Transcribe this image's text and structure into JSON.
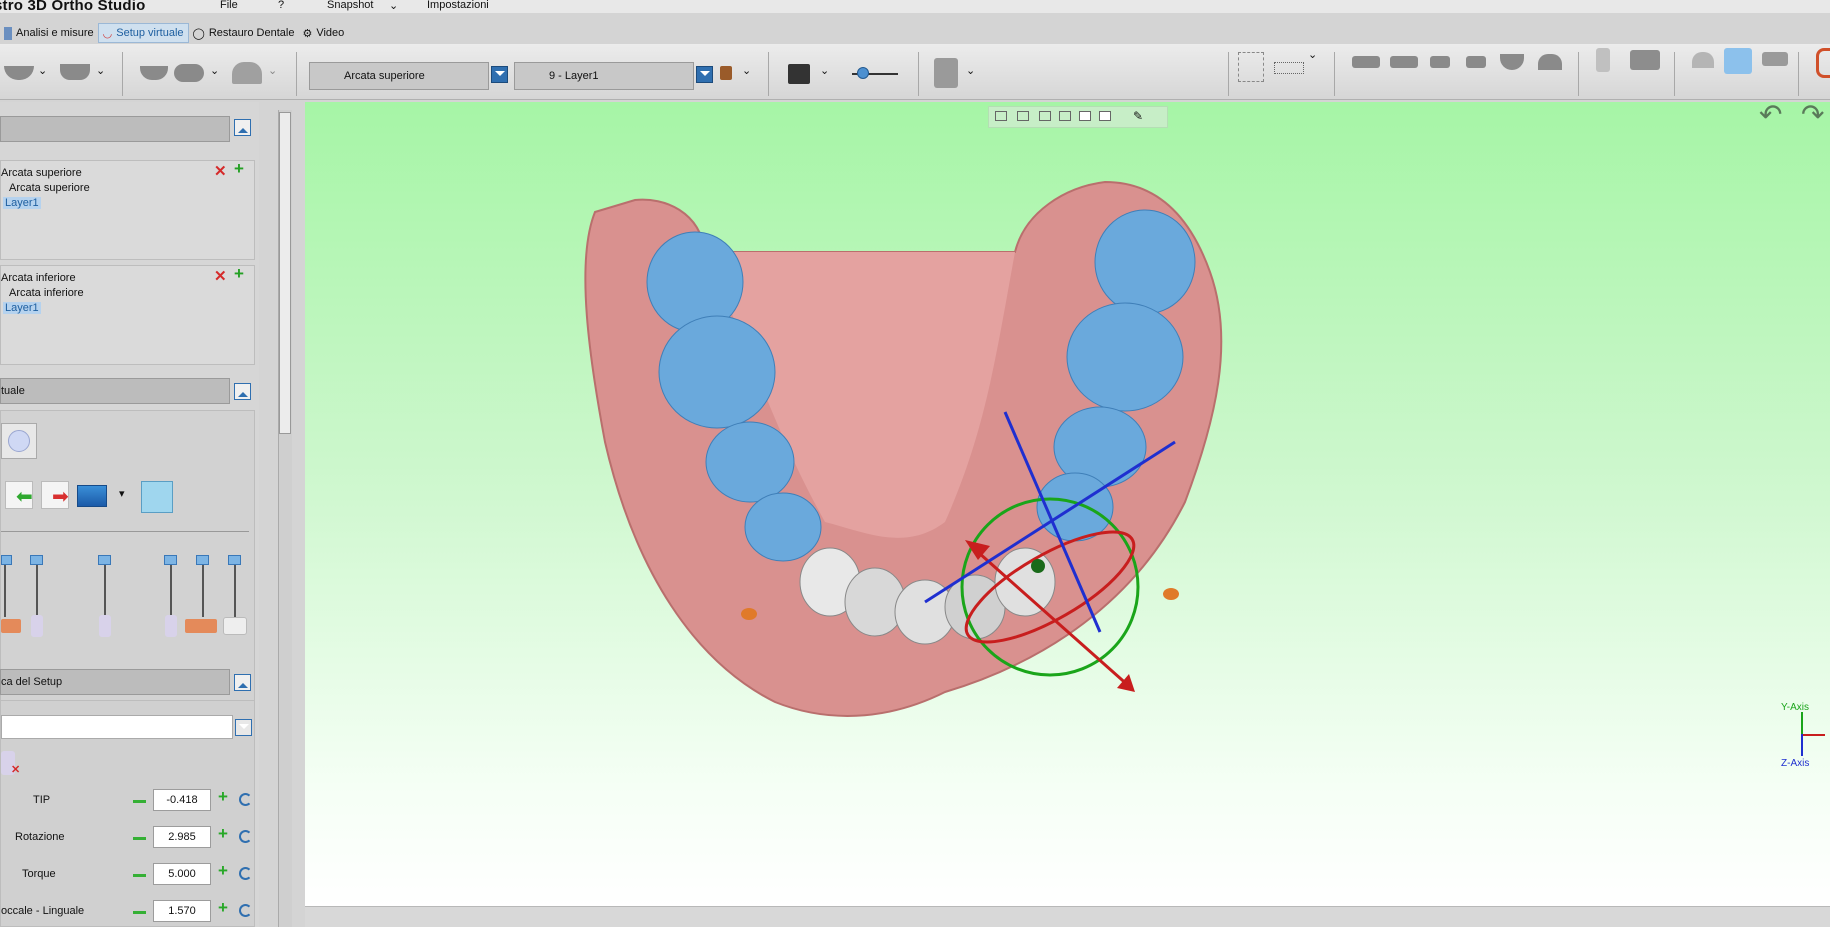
{
  "app": {
    "title": "stro 3D Ortho Studio"
  },
  "menu": [
    "File",
    "?",
    "Snapshot",
    "Impostazioni"
  ],
  "tabs": [
    {
      "label": "Analisi e misure",
      "active": false
    },
    {
      "label": "Setup virtuale",
      "active": true
    },
    {
      "label": "Restauro Dentale",
      "active": false
    },
    {
      "label": "Video",
      "active": false
    }
  ],
  "toolbar": {
    "arch_select": "Arcata superiore",
    "layer_select": "9 - Layer1"
  },
  "models_panel": {
    "upper": {
      "name": "Arcata superiore",
      "child": "Arcata superiore",
      "layer": "Layer1"
    },
    "lower": {
      "name": "Arcata inferiore",
      "child": "Arcata inferiore",
      "layer": "Layer1"
    }
  },
  "setup_panel": {
    "title": "tuale"
  },
  "verify_panel": {
    "title": "ca del Setup",
    "params": [
      {
        "label": "TIP",
        "value": "-0.418"
      },
      {
        "label": "Rotazione",
        "value": "2.985"
      },
      {
        "label": "Torque",
        "value": "5.000"
      },
      {
        "label": "occale - Linguale",
        "value": "1.570"
      }
    ]
  },
  "axes": {
    "y": "Y-Axis",
    "z": "Z-Axis"
  },
  "colors": {
    "viewport_top": "#a6f5a6",
    "gum": "#d9918f",
    "tooth": "#6aa9dc",
    "accent": "#2f6fb0"
  }
}
